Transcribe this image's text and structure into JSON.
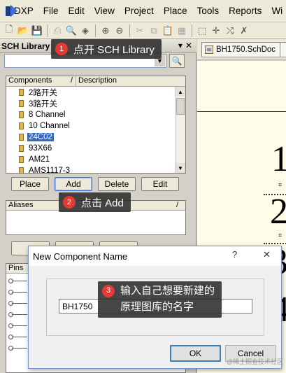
{
  "menu": {
    "items": [
      "DXP",
      "File",
      "Edit",
      "View",
      "Project",
      "Place",
      "Tools",
      "Reports",
      "Wi"
    ]
  },
  "toolbar": {
    "icons": [
      "new-icon",
      "open-icon",
      "save-icon",
      "print-icon",
      "print-preview-icon",
      "component-icon",
      "zoom-in-icon",
      "zoom-out-icon",
      "cut-icon",
      "copy-icon",
      "paste-icon",
      "paste-array-icon",
      "select-icon",
      "move-icon",
      "deselect-icon",
      "clear-filter-icon"
    ]
  },
  "panel": {
    "title": "SCH Library",
    "pin_icon": "📌",
    "close_icon": "✕",
    "components_header": "Components",
    "sort_indicator": "/",
    "description_header": "Description",
    "components": [
      "2路开关",
      "3路开关",
      "8 Channel",
      "10 Channel",
      "24C02",
      "93X66",
      "AM21",
      "AMS1117-3"
    ],
    "selected_component": "24C02",
    "buttons": {
      "place": "Place",
      "add": "Add",
      "delete": "Delete",
      "edit": "Edit"
    },
    "aliases_header": "Aliases",
    "pins_header": "Pins"
  },
  "document": {
    "tab_label": "BH1750.SchDoc",
    "sheet_numbers": [
      "1",
      "2",
      "3",
      "4"
    ]
  },
  "callouts": {
    "c1": {
      "num": "1",
      "text": "点开 SCH Library"
    },
    "c2": {
      "num": "2",
      "text": "点击 Add"
    },
    "c3": {
      "num": "3",
      "line1": "输入自己想要新建的",
      "line2": "原理图库的名字"
    }
  },
  "dialog": {
    "title": "New Component Name",
    "help_label": "?",
    "close_label": "✕",
    "input_value": "BH1750",
    "ok_label": "OK",
    "cancel_label": "Cancel"
  },
  "watermark": "@稀土掘金技术社区",
  "colors": {
    "selection": "#316ac5",
    "callout_badge": "#e53935",
    "sheet_background": "#fffde8"
  }
}
